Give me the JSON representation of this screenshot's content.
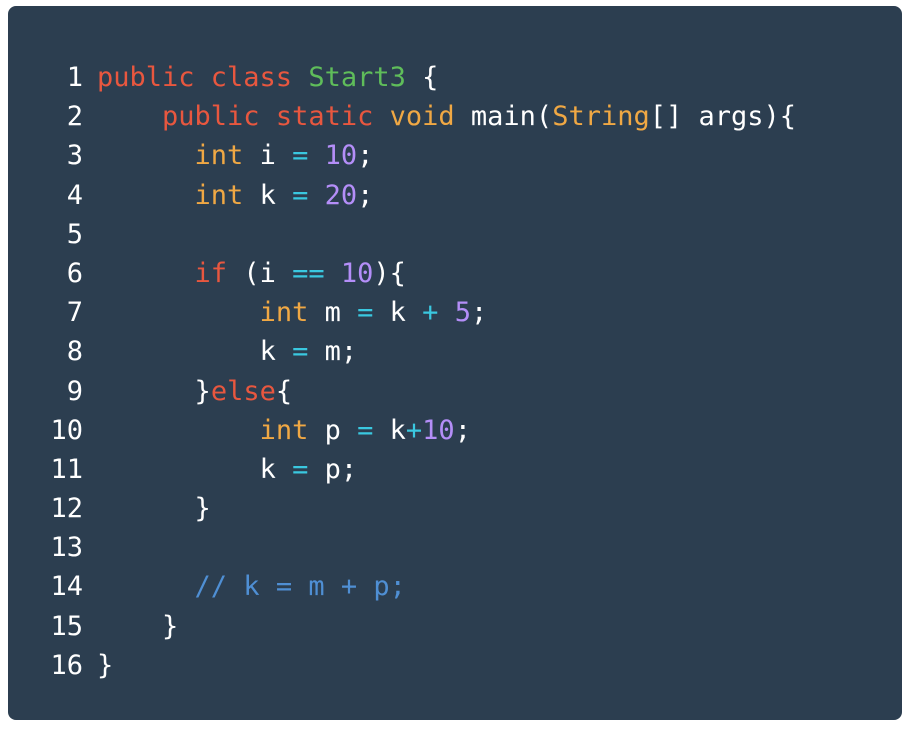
{
  "editor": {
    "lines": [
      {
        "number": "1",
        "tokens": [
          {
            "t": "public class ",
            "k": "keyword"
          },
          {
            "t": "Start3",
            "k": "classname"
          },
          {
            "t": " {",
            "k": "plain"
          }
        ]
      },
      {
        "number": "2",
        "tokens": [
          {
            "t": "    ",
            "k": "plain"
          },
          {
            "t": "public static ",
            "k": "keyword"
          },
          {
            "t": "void",
            "k": "type"
          },
          {
            "t": " main(",
            "k": "plain"
          },
          {
            "t": "String",
            "k": "type"
          },
          {
            "t": "[] args){",
            "k": "plain"
          }
        ]
      },
      {
        "number": "3",
        "tokens": [
          {
            "t": "      ",
            "k": "plain"
          },
          {
            "t": "int",
            "k": "type"
          },
          {
            "t": " i ",
            "k": "plain"
          },
          {
            "t": "=",
            "k": "operator"
          },
          {
            "t": " ",
            "k": "plain"
          },
          {
            "t": "10",
            "k": "number"
          },
          {
            "t": ";",
            "k": "plain"
          }
        ]
      },
      {
        "number": "4",
        "tokens": [
          {
            "t": "      ",
            "k": "plain"
          },
          {
            "t": "int",
            "k": "type"
          },
          {
            "t": " k ",
            "k": "plain"
          },
          {
            "t": "=",
            "k": "operator"
          },
          {
            "t": " ",
            "k": "plain"
          },
          {
            "t": "20",
            "k": "number"
          },
          {
            "t": ";",
            "k": "plain"
          }
        ]
      },
      {
        "number": "5",
        "tokens": []
      },
      {
        "number": "6",
        "tokens": [
          {
            "t": "      ",
            "k": "plain"
          },
          {
            "t": "if",
            "k": "keyword"
          },
          {
            "t": " (i ",
            "k": "plain"
          },
          {
            "t": "==",
            "k": "operator"
          },
          {
            "t": " ",
            "k": "plain"
          },
          {
            "t": "10",
            "k": "number"
          },
          {
            "t": "){",
            "k": "plain"
          }
        ]
      },
      {
        "number": "7",
        "tokens": [
          {
            "t": "          ",
            "k": "plain"
          },
          {
            "t": "int",
            "k": "type"
          },
          {
            "t": " m ",
            "k": "plain"
          },
          {
            "t": "=",
            "k": "operator"
          },
          {
            "t": " k ",
            "k": "plain"
          },
          {
            "t": "+",
            "k": "operator"
          },
          {
            "t": " ",
            "k": "plain"
          },
          {
            "t": "5",
            "k": "number"
          },
          {
            "t": ";",
            "k": "plain"
          }
        ]
      },
      {
        "number": "8",
        "tokens": [
          {
            "t": "          ",
            "k": "plain"
          },
          {
            "t": "k ",
            "k": "plain"
          },
          {
            "t": "=",
            "k": "operator"
          },
          {
            "t": " m;",
            "k": "plain"
          }
        ]
      },
      {
        "number": "9",
        "tokens": [
          {
            "t": "      ",
            "k": "plain"
          },
          {
            "t": "}",
            "k": "plain"
          },
          {
            "t": "else",
            "k": "keyword"
          },
          {
            "t": "{",
            "k": "plain"
          }
        ]
      },
      {
        "number": "10",
        "tokens": [
          {
            "t": "          ",
            "k": "plain"
          },
          {
            "t": "int",
            "k": "type"
          },
          {
            "t": " p ",
            "k": "plain"
          },
          {
            "t": "=",
            "k": "operator"
          },
          {
            "t": " k",
            "k": "plain"
          },
          {
            "t": "+",
            "k": "operator"
          },
          {
            "t": "10",
            "k": "number"
          },
          {
            "t": ";",
            "k": "plain"
          }
        ]
      },
      {
        "number": "11",
        "tokens": [
          {
            "t": "          ",
            "k": "plain"
          },
          {
            "t": "k ",
            "k": "plain"
          },
          {
            "t": "=",
            "k": "operator"
          },
          {
            "t": " p;",
            "k": "plain"
          }
        ]
      },
      {
        "number": "12",
        "tokens": [
          {
            "t": "      ",
            "k": "plain"
          },
          {
            "t": "}",
            "k": "plain"
          }
        ]
      },
      {
        "number": "13",
        "tokens": []
      },
      {
        "number": "14",
        "tokens": [
          {
            "t": "      ",
            "k": "plain"
          },
          {
            "t": "// k = m + p;",
            "k": "comment"
          }
        ]
      },
      {
        "number": "15",
        "tokens": [
          {
            "t": "    ",
            "k": "plain"
          },
          {
            "t": "}",
            "k": "plain"
          }
        ]
      },
      {
        "number": "16",
        "tokens": [
          {
            "t": "}",
            "k": "plain"
          }
        ]
      }
    ]
  },
  "theme": {
    "background": "#2c3e50",
    "keyword": "#e8573f",
    "type": "#f0a844",
    "classname": "#5fbd5a",
    "number": "#b48ef8",
    "operator": "#3ac8e0",
    "comment": "#4f8fd4",
    "plain": "#ffffff"
  }
}
